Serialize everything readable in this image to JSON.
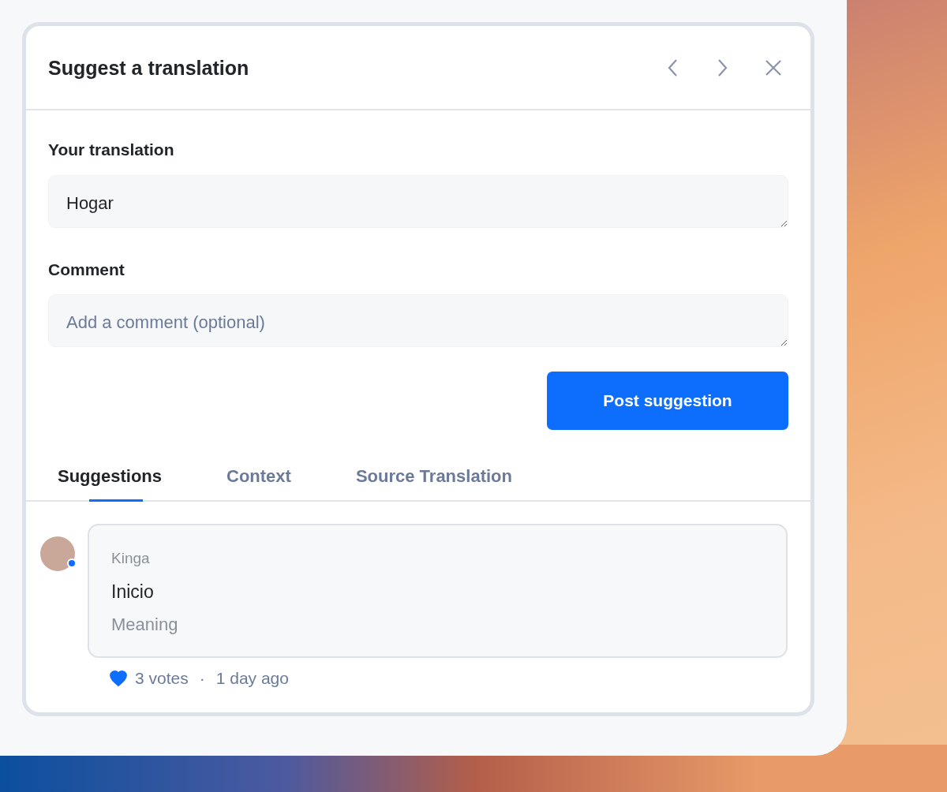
{
  "dialog": {
    "title": "Suggest a translation"
  },
  "fields": [
    {
      "label": "Your translation",
      "value": "Hogar"
    },
    {
      "label": "Comment",
      "placeholder": "Add a comment (optional)"
    }
  ],
  "submit_button": "Post suggestion",
  "tabs": [
    {
      "label": "Suggestions",
      "selected": true
    },
    {
      "label": "Context",
      "selected": false
    },
    {
      "label": "Source Translation",
      "selected": false
    }
  ],
  "suggestions": [
    {
      "author": "Kinga",
      "online": true,
      "text": "Inicio",
      "note": "Meaning",
      "liked": true,
      "votes": "3 votes",
      "separator": "·",
      "time": "1 day ago"
    }
  ]
}
